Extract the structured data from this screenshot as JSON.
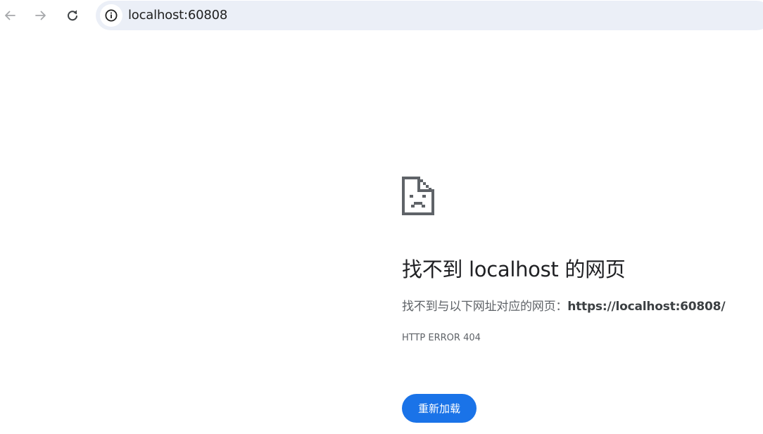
{
  "browser": {
    "back_icon": "arrow-left-icon",
    "forward_icon": "arrow-right-icon",
    "reload_icon": "reload-icon",
    "site_info_icon": "info-circle-icon",
    "url": "localhost:60808"
  },
  "error": {
    "icon": "sad-document-icon",
    "title": "找不到 localhost 的网页",
    "description_prefix": "找不到与以下网址对应的网页：",
    "description_url": "https://localhost:60808/",
    "code": "HTTP ERROR 404",
    "reload_label": "重新加载"
  },
  "colors": {
    "accent": "#1a73e8",
    "omnibox_bg": "#ebeff7",
    "title_text": "#202124",
    "secondary_text": "#5f6368"
  }
}
